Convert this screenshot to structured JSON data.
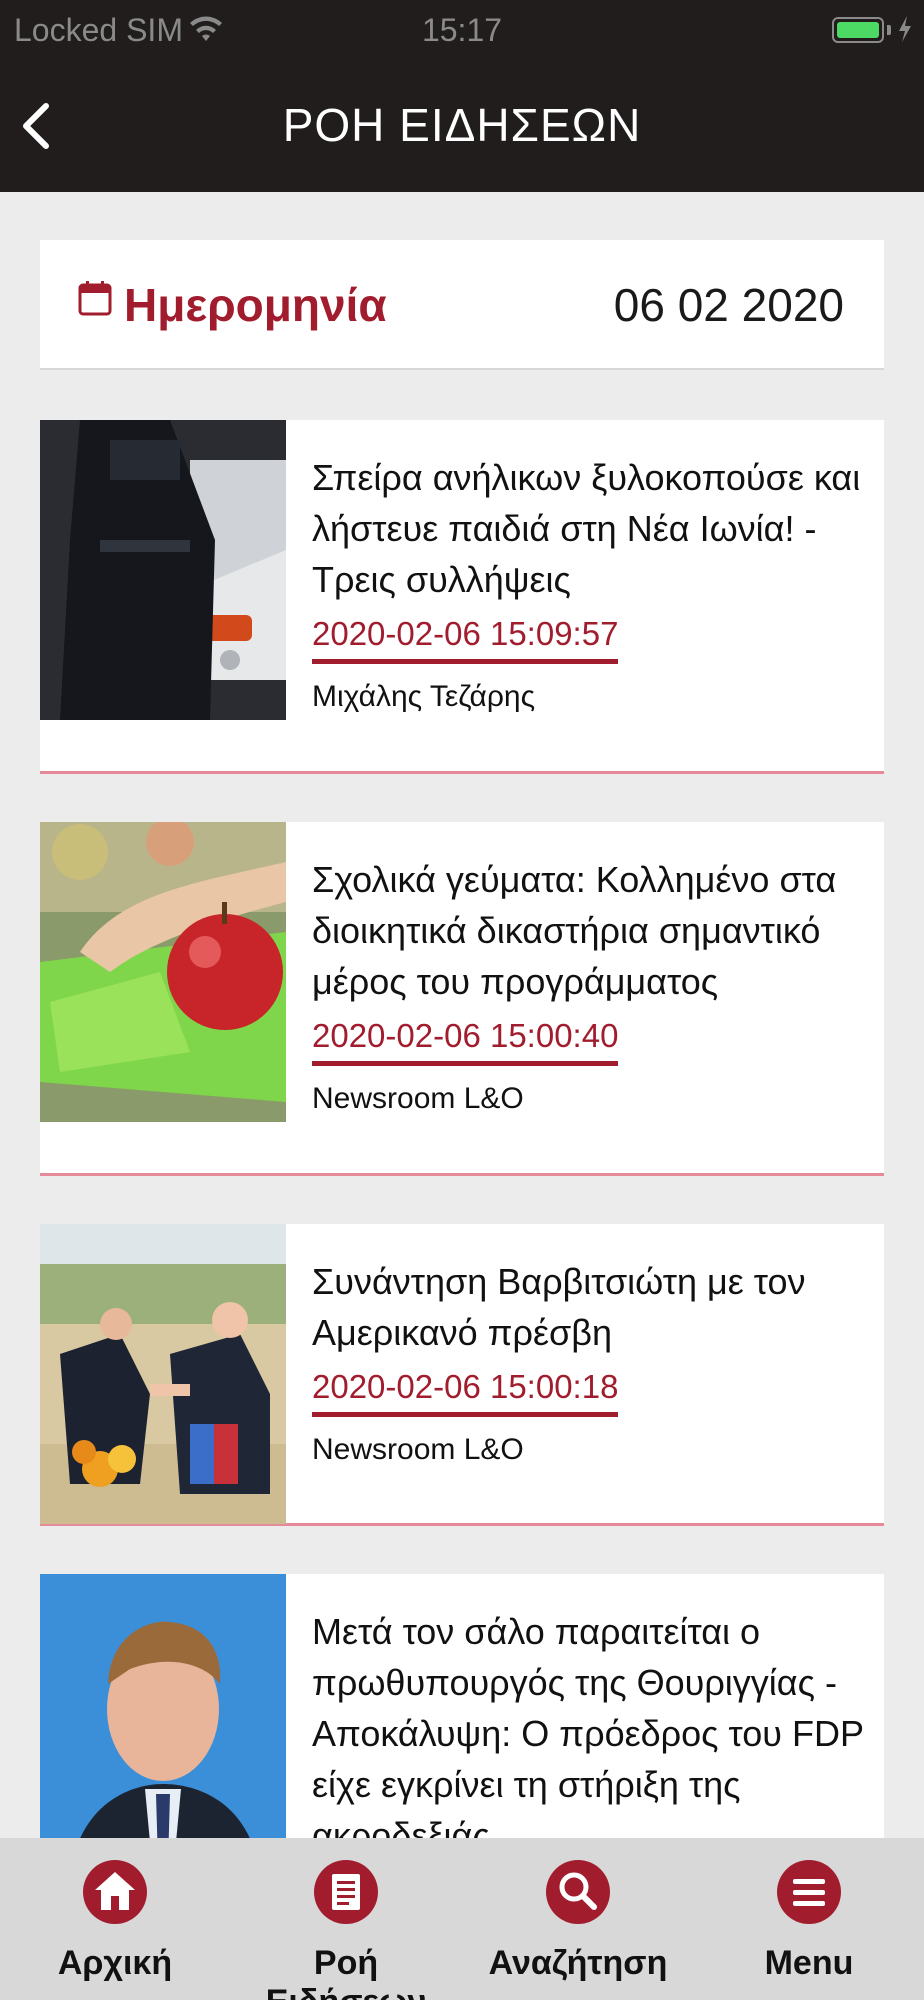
{
  "status_bar": {
    "carrier": "Locked SIM",
    "time": "15:17"
  },
  "header": {
    "title": "ΡΟΗ ΕΙΔΗΣΕΩΝ",
    "back_icon": "chevron-left-icon"
  },
  "date_filter": {
    "label": "Ημερομηνία",
    "value": "06 02 2020",
    "icon": "calendar-icon"
  },
  "news": [
    {
      "title": "Σπείρα ανήλικων ξυλοκοπούσε και λήστευε παιδιά στη Νέα Ιωνία! - Τρεις συλλήψεις",
      "time": "2020-02-06 15:09:57",
      "author": "Μιχάλης Τεζάρης"
    },
    {
      "title": "Σχολικά γεύματα: Κολλημένο στα διοικητικά δικαστήρια σημαντικό μέρος του προγράμματος",
      "time": "2020-02-06 15:00:40",
      "author": "Newsroom L&O"
    },
    {
      "title": "Συνάντηση Βαρβιτσιώτη με τον Αμερικανό πρέσβη",
      "time": "2020-02-06 15:00:18",
      "author": "Newsroom L&O"
    },
    {
      "title": "Μετά τον σάλο παραιτείται ο πρωθυπουργός της Θουριγγίας - Αποκάλυψη: Ο πρόεδρος του FDP είχε εγκρίνει τη στήριξη της ακροδεξιάς",
      "time": "",
      "author": ""
    }
  ],
  "tabbar": {
    "items": [
      {
        "label": "Αρχική",
        "icon": "home-icon"
      },
      {
        "label": "Ροή Ειδήσεων",
        "icon": "news-feed-icon"
      },
      {
        "label": "Αναζήτηση",
        "icon": "search-icon"
      },
      {
        "label": "Menu",
        "icon": "menu-icon"
      }
    ]
  },
  "colors": {
    "accent": "#a11d2e",
    "header_bg": "#211d1d",
    "page_bg": "#ececec",
    "card_divider": "#e48a98"
  }
}
